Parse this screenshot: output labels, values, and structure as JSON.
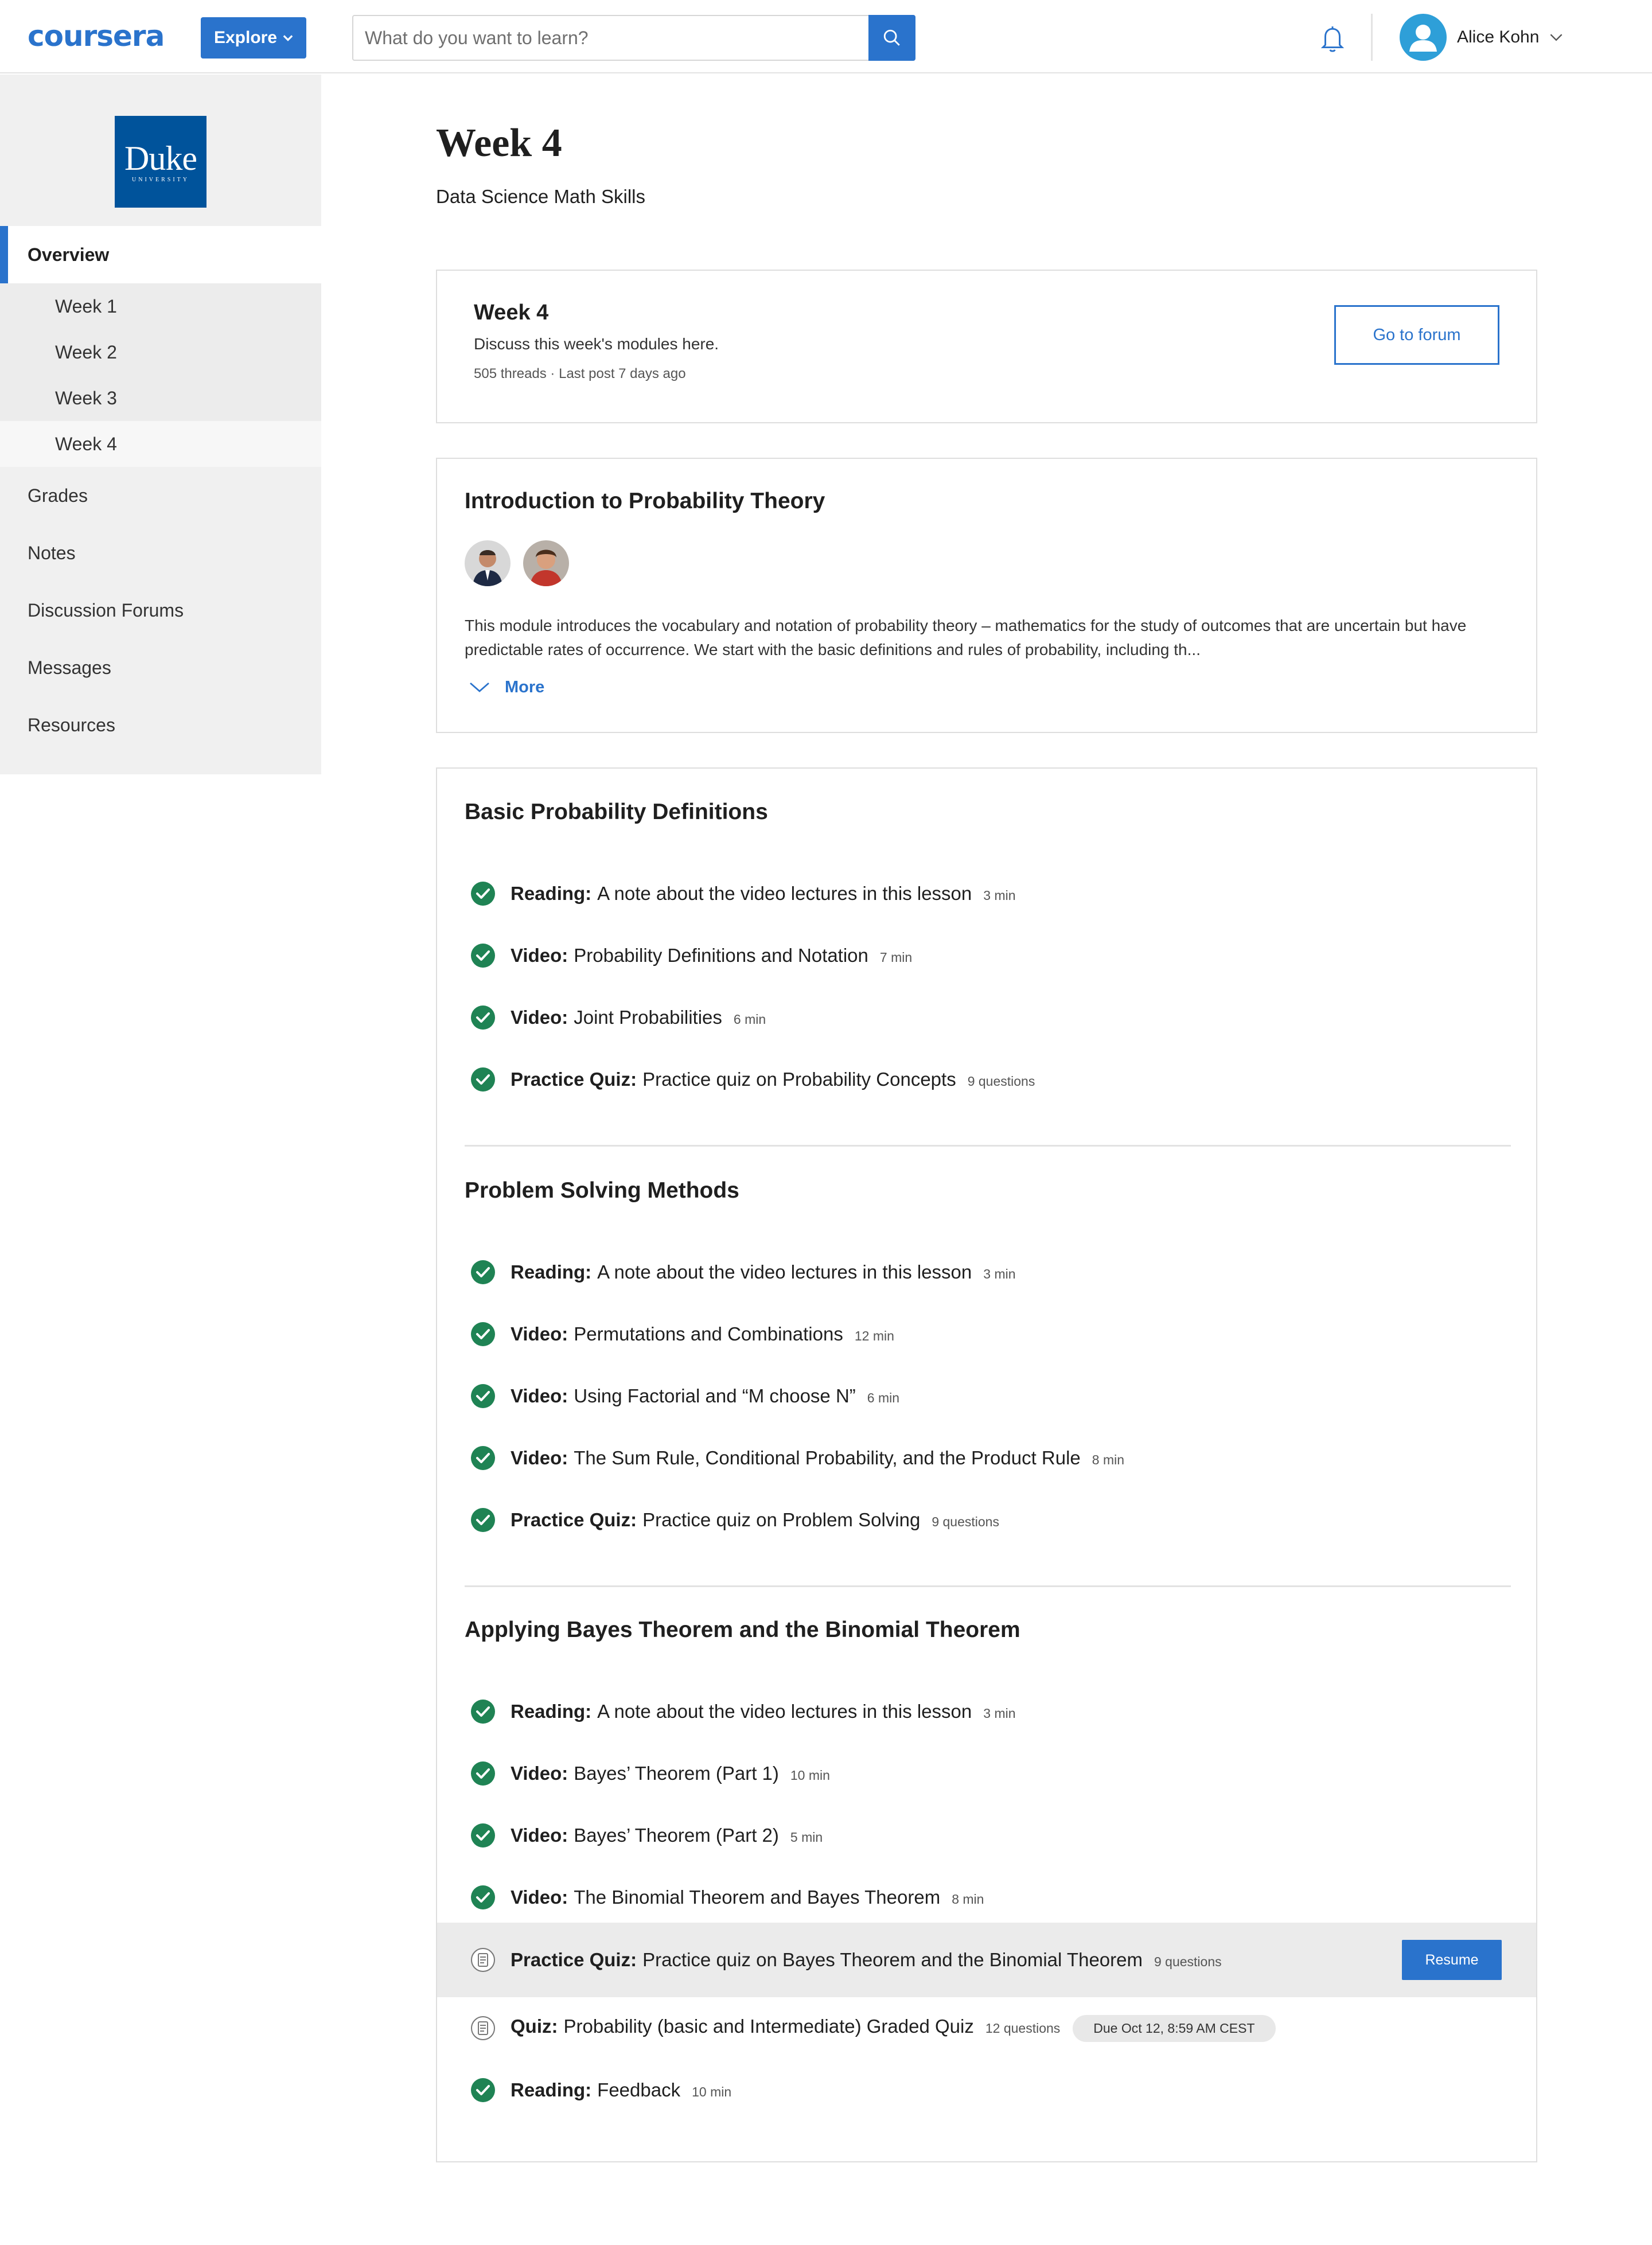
{
  "header": {
    "logo": "coursera",
    "explore_label": "Explore",
    "search_placeholder": "What do you want to learn?",
    "user_name": "Alice Kohn",
    "accent_color": "#2a73cc"
  },
  "sidebar": {
    "university_logo_text": "Duke",
    "university_logo_subtext": "UNIVERSITY",
    "overview_label": "Overview",
    "weeks": [
      "Week 1",
      "Week 2",
      "Week 3",
      "Week 4"
    ],
    "items": [
      "Grades",
      "Notes",
      "Discussion Forums",
      "Messages",
      "Resources"
    ]
  },
  "page": {
    "title": "Week 4",
    "subtitle": "Data Science Math Skills"
  },
  "forum": {
    "title": "Week 4",
    "description": "Discuss this week's modules here.",
    "meta": "505 threads · Last post 7 days ago",
    "button_label": "Go to forum"
  },
  "intro": {
    "title": "Introduction to Probability Theory",
    "text": "This module introduces the vocabulary and notation of probability theory – mathematics for the study of outcomes that are uncertain but have predictable rates of occurrence. We start with the basic definitions and rules of probability, including th...",
    "more_label": "More"
  },
  "lessons": [
    {
      "title": "Basic Probability Definitions",
      "items": [
        {
          "type": "Reading:",
          "name": "A note about the video lectures in this lesson",
          "meta": "3 min",
          "status": "done"
        },
        {
          "type": "Video:",
          "name": "Probability Definitions and Notation",
          "meta": "7 min",
          "status": "done"
        },
        {
          "type": "Video:",
          "name": "Joint Probabilities",
          "meta": "6 min",
          "status": "done"
        },
        {
          "type": "Practice Quiz:",
          "name": "Practice quiz on Probability Concepts",
          "meta": "9 questions",
          "status": "done"
        }
      ]
    },
    {
      "title": "Problem Solving Methods",
      "items": [
        {
          "type": "Reading:",
          "name": "A note about the video lectures in this lesson",
          "meta": "3 min",
          "status": "done"
        },
        {
          "type": "Video:",
          "name": "Permutations and Combinations",
          "meta": "12 min",
          "status": "done"
        },
        {
          "type": "Video:",
          "name": "Using Factorial and “M choose N”",
          "meta": "6 min",
          "status": "done"
        },
        {
          "type": "Video:",
          "name": "The Sum Rule, Conditional Probability, and the Product Rule",
          "meta": "8 min",
          "status": "done"
        },
        {
          "type": "Practice Quiz:",
          "name": "Practice quiz on Problem Solving",
          "meta": "9 questions",
          "status": "done"
        }
      ]
    },
    {
      "title": "Applying Bayes Theorem and the Binomial Theorem",
      "items": [
        {
          "type": "Reading:",
          "name": "A note about the video lectures in this lesson",
          "meta": "3 min",
          "status": "done"
        },
        {
          "type": "Video:",
          "name": "Bayes’ Theorem (Part 1)",
          "meta": "10 min",
          "status": "done"
        },
        {
          "type": "Video:",
          "name": "Bayes’ Theorem (Part 2)",
          "meta": "5 min",
          "status": "done"
        },
        {
          "type": "Video:",
          "name": "The Binomial Theorem and Bayes Theorem",
          "meta": "8 min",
          "status": "done"
        },
        {
          "type": "Practice Quiz:",
          "name": "Practice quiz on Bayes Theorem and the Binomial Theorem",
          "meta": "9 questions",
          "status": "in-progress",
          "action_label": "Resume"
        },
        {
          "type": "Quiz:",
          "name": "Probability (basic and Intermediate) Graded Quiz",
          "meta": "12 questions",
          "status": "todo",
          "due": "Due Oct 12, 8:59 AM CEST"
        },
        {
          "type": "Reading:",
          "name": "Feedback",
          "meta": "10 min",
          "status": "done"
        }
      ]
    }
  ]
}
